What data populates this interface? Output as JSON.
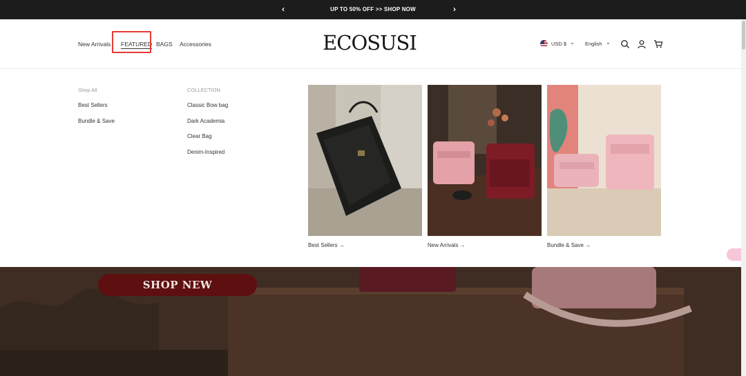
{
  "announcement": {
    "text": "UP TO 50% OFF >> SHOP NOW",
    "prev_icon": "chevron-left-icon",
    "next_icon": "chevron-right-icon"
  },
  "header": {
    "nav": [
      {
        "label": "New Arrivals"
      },
      {
        "label": "FEATURED"
      },
      {
        "label": "BAGS"
      },
      {
        "label": "Accessories"
      }
    ],
    "logo": "ECOSUSI",
    "currency": "USD $",
    "language": "English",
    "icons": [
      "search-icon",
      "account-icon",
      "cart-icon"
    ]
  },
  "mega_menu": {
    "col1": {
      "heading": "Shop All",
      "items": [
        "Best Sellers",
        "Bundle & Save"
      ]
    },
    "col2": {
      "heading": "COLLECTION",
      "items": [
        "Classic Bow bag",
        "Dark Academia",
        "Clear Bag",
        "Denim-Inspired"
      ]
    },
    "cards": [
      {
        "caption": "Best Sellers →"
      },
      {
        "caption": "New Arrivals →"
      },
      {
        "caption": "Bundle & Save →"
      }
    ]
  },
  "hero": {
    "button": "SHOP NEW"
  },
  "colors": {
    "accent": "#5e0f10",
    "highlight": "#e53935",
    "topbar": "#1c1c1c"
  }
}
